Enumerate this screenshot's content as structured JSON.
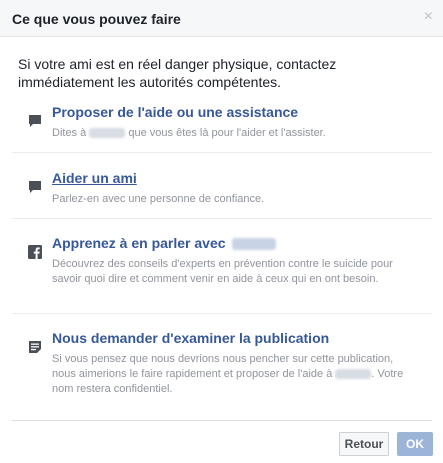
{
  "dialog": {
    "title": "Ce que vous pouvez faire",
    "close_symbol": "×",
    "intro": "Si votre ami est en réel danger physique, contactez immédiatement les autorités compétentes."
  },
  "options": [
    {
      "icon": "comment-icon",
      "label": "Proposer de l'aide ou une assistance",
      "desc_before": "Dites à",
      "desc_after": "que vous êtes là pour l'aider et l'assister."
    },
    {
      "icon": "comment-icon",
      "label": "Aider un ami",
      "desc": "Parlez-en avec une personne de confiance."
    },
    {
      "icon": "facebook-icon",
      "label": "Apprenez à en parler avec",
      "desc": "Découvrez des conseils d'experts en prévention contre le suicide pour savoir quoi dire et comment venir en aide à ceux qui en ont besoin."
    },
    {
      "icon": "report-icon",
      "label": "Nous demander d'examiner la publication",
      "desc_before": "Si vous pensez que nous devrions nous pencher sur cette publication, nous aimerions le faire rapidement et proposer de l'aide à",
      "desc_after": ". Votre nom restera confidentiel."
    }
  ],
  "footer": {
    "back_label": "Retour",
    "ok_label": "OK"
  },
  "colors": {
    "link": "#365899",
    "muted": "#90949c",
    "icon": "#4b4f56",
    "ok_disabled": "#9cb4d8"
  }
}
